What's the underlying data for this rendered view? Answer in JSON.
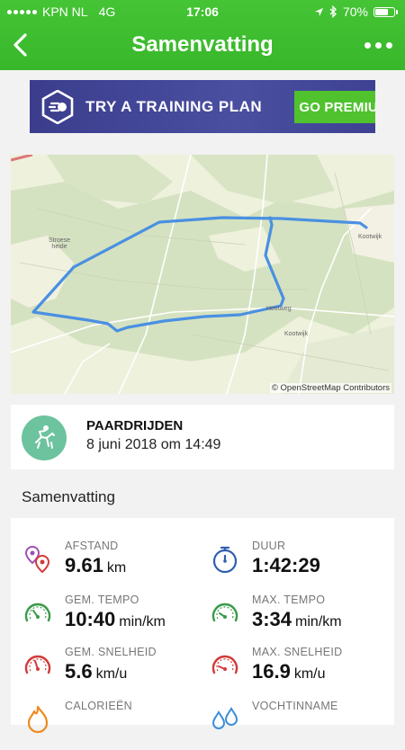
{
  "status_bar": {
    "carrier": "KPN NL",
    "network": "4G",
    "time": "17:06",
    "battery": "70%"
  },
  "nav": {
    "title": "Samenvatting",
    "back_icon": "chevron-left-icon",
    "more_icon": "more-dots-icon"
  },
  "banner": {
    "text": "TRY A TRAINING PLAN",
    "button_label": "GO PREMIUM",
    "colors": {
      "background": "#3e4192",
      "button": "#4fc22d"
    }
  },
  "map": {
    "attribution": "© OpenStreetMap Contributors",
    "labels": [
      "Stroese heide",
      "Kootwijk",
      "Kootwijk",
      "Heetweg"
    ]
  },
  "activity": {
    "type": "PAARDRIJDEN",
    "date": "8 juni 2018 om 14:49",
    "icon": "horse-riding-icon"
  },
  "summary_title": "Samenvatting",
  "stats": [
    {
      "label": "AFSTAND",
      "value": "9.61",
      "unit": "km",
      "icon": "distance-pin-icon",
      "color": "#a14fb5"
    },
    {
      "label": "DUUR",
      "value": "1:42:29",
      "unit": "",
      "icon": "stopwatch-icon",
      "color": "#2f5fb0"
    },
    {
      "label": "GEM. TEMPO",
      "value": "10:40",
      "unit": "min/km",
      "icon": "gauge-icon",
      "color": "#3a9a4a"
    },
    {
      "label": "MAX. TEMPO",
      "value": "3:34",
      "unit": "min/km",
      "icon": "gauge-icon",
      "color": "#3a9a4a"
    },
    {
      "label": "GEM. SNELHEID",
      "value": "5.6",
      "unit": "km/u",
      "icon": "speedometer-icon",
      "color": "#d33a3a"
    },
    {
      "label": "MAX. SNELHEID",
      "value": "16.9",
      "unit": "km/u",
      "icon": "speedometer-icon",
      "color": "#d33a3a"
    },
    {
      "label": "CALORIEËN",
      "value": "",
      "unit": "",
      "icon": "flame-icon",
      "color": "#f08a1c"
    },
    {
      "label": "VOCHTINNAME",
      "value": "",
      "unit": "",
      "icon": "water-drop-icon",
      "color": "#3d8fd8"
    }
  ]
}
